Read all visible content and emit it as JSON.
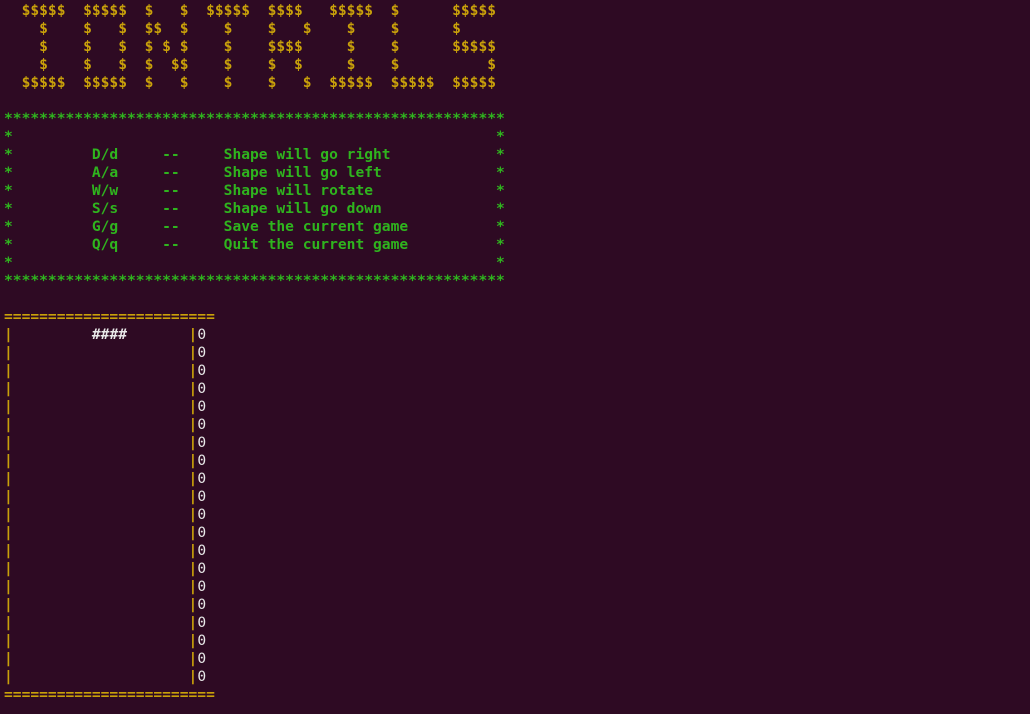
{
  "banner": [
    "  $$$$$  $$$$$  $   $  $$$$$  $$$$   $$$$$  $      $$$$$",
    "    $    $   $  $$  $    $    $   $    $    $      $    ",
    "    $    $   $  $ $ $    $    $$$$     $    $      $$$$$",
    "    $    $   $  $  $$    $    $  $     $    $          $",
    "  $$$$$  $$$$$  $   $    $    $   $  $$$$$  $$$$$  $$$$$"
  ],
  "blank": "",
  "help_border_top": "*********************************************************",
  "help_blank": "*                                                       *",
  "help_rows": [
    "*         D/d     --     Shape will go right            *",
    "*         A/a     --     Shape will go left             *",
    "*         W/w     --     Shape will rotate              *",
    "*         S/s     --     Shape will go down             *",
    "*         G/g     --     Save the current game          *",
    "*         Q/q     --     Quit the current game          *"
  ],
  "help_border_bottom": "*********************************************************",
  "board": {
    "rule": "========================",
    "piece_row": {
      "left": "|",
      "pad_left": "         ",
      "piece": "####",
      "pad_right": "       ",
      "right": "|",
      "zero": "0"
    },
    "empty_row": {
      "left": "|",
      "pad": "                    ",
      "right": "|",
      "zero": "0"
    },
    "empty_row_count": 19
  }
}
